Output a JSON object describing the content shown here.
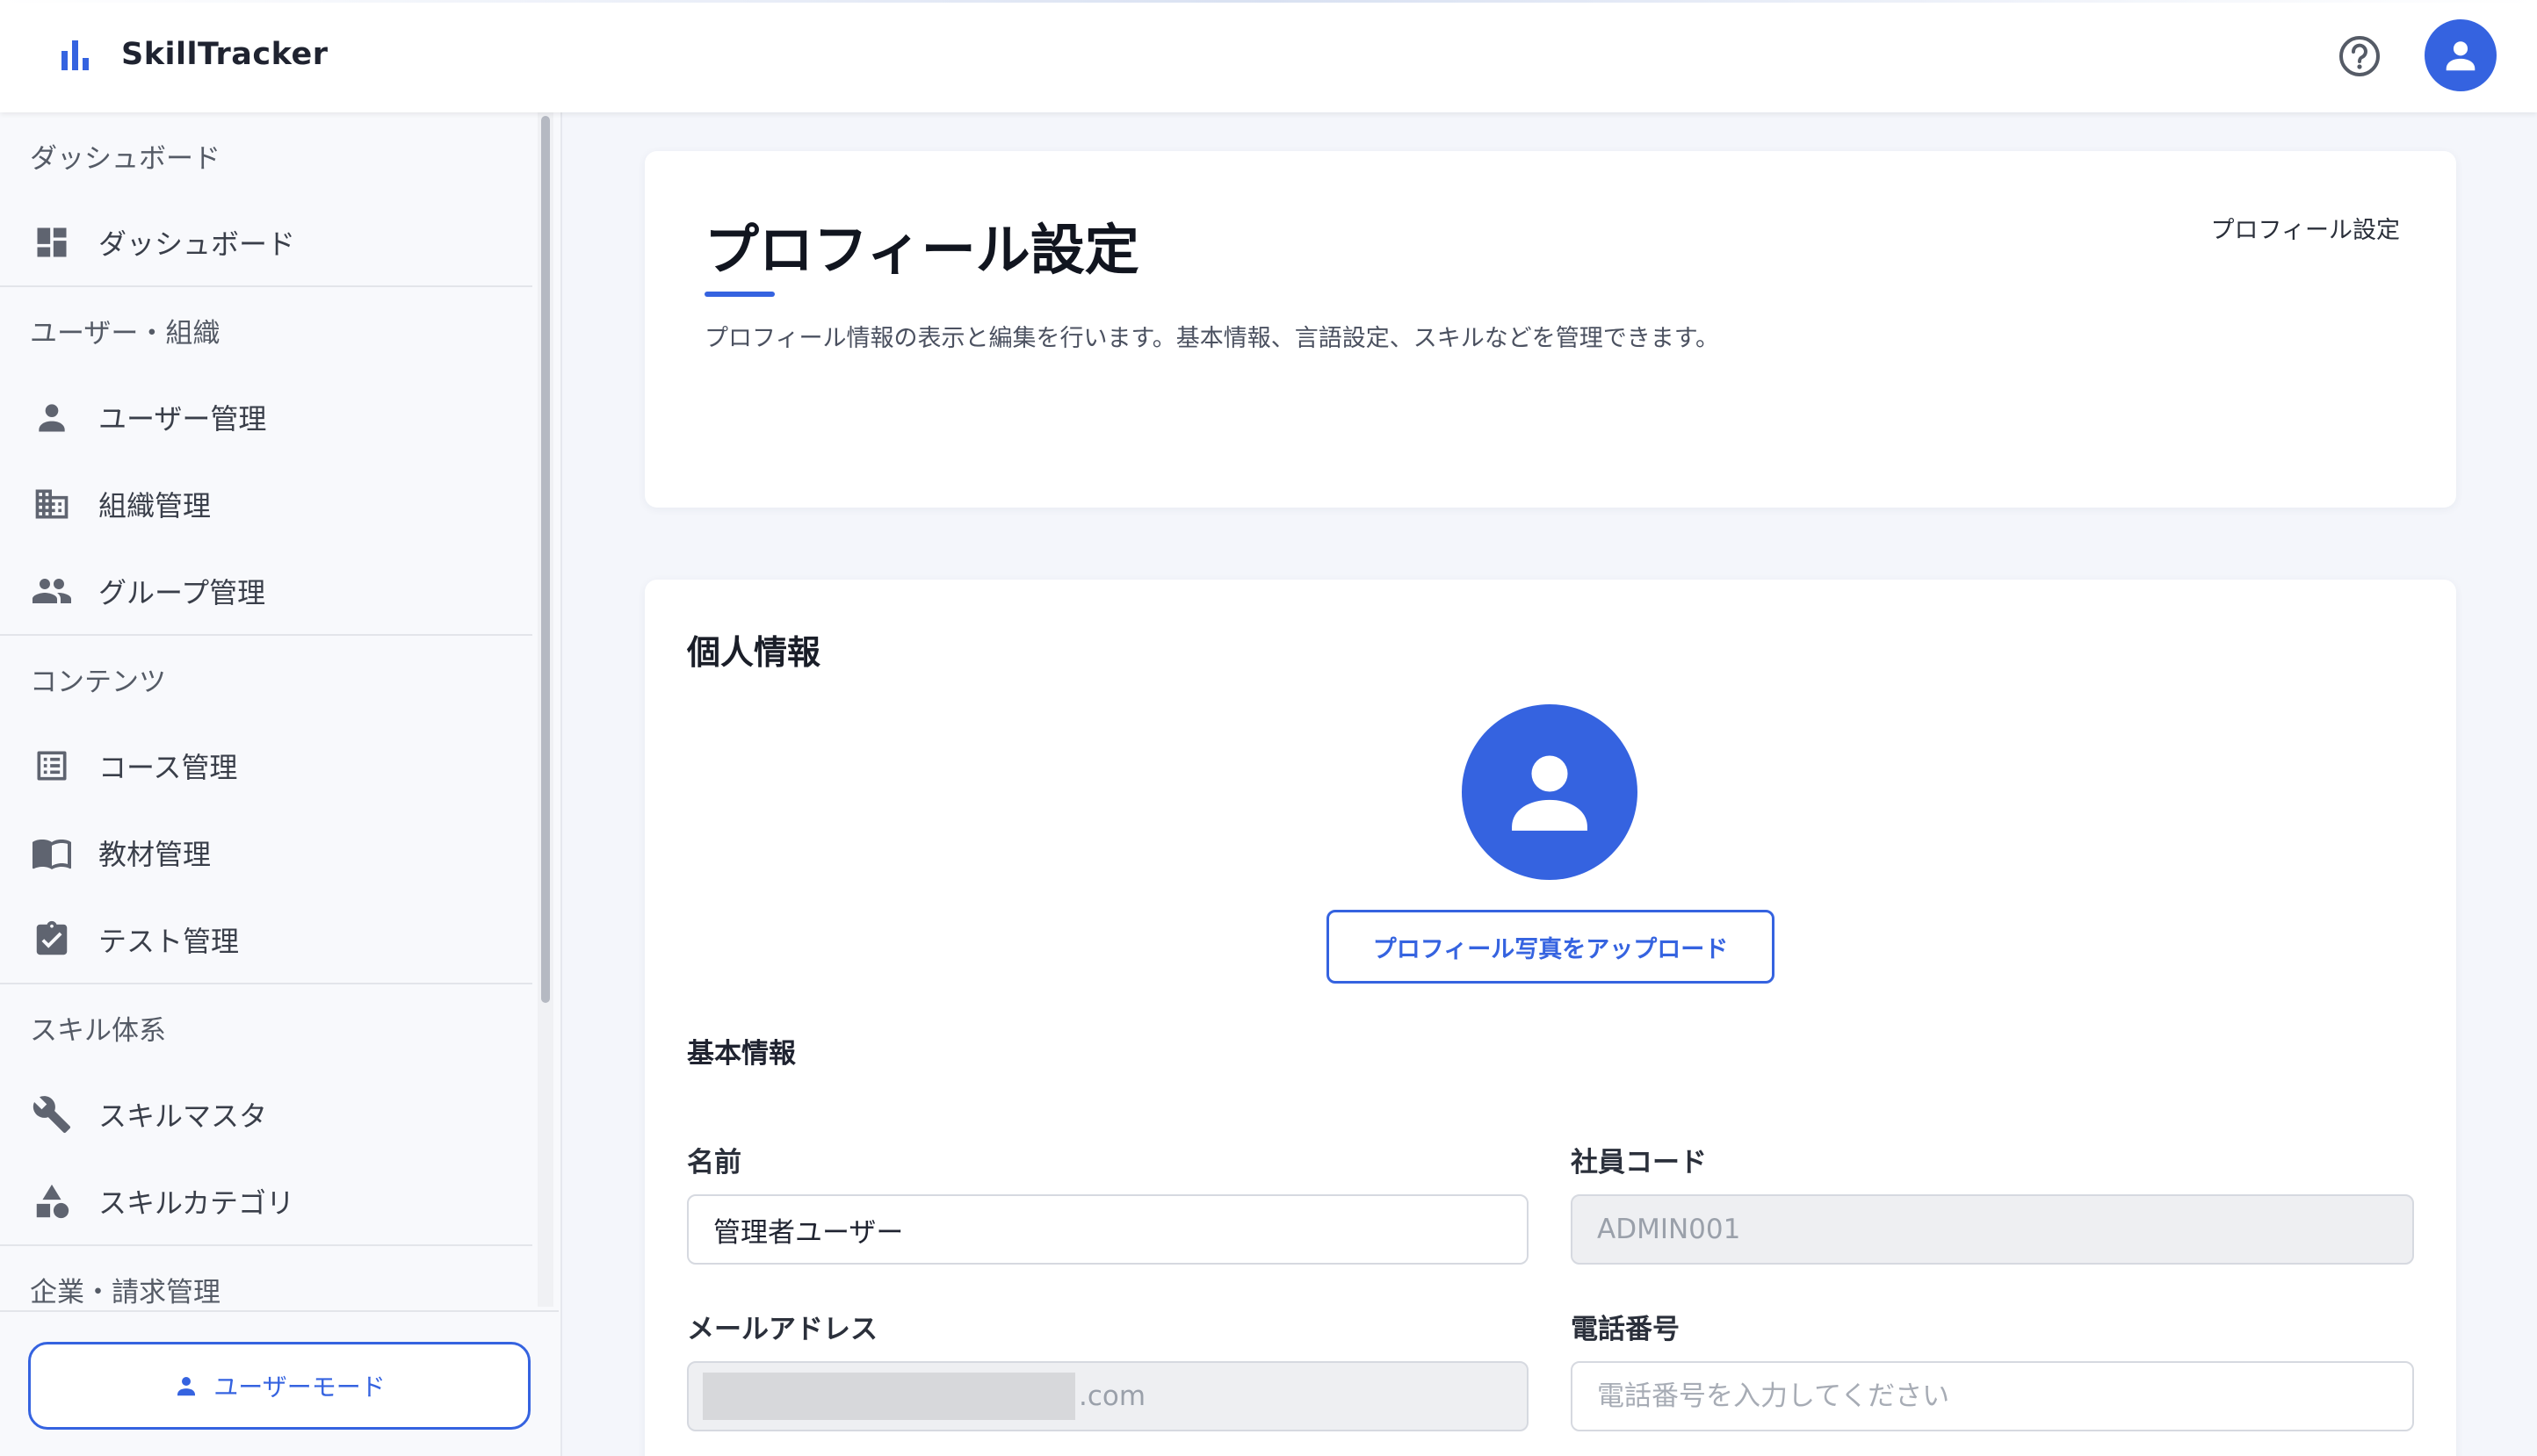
{
  "header": {
    "brand": "SkillTracker"
  },
  "sidebar": {
    "groups": [
      {
        "title": "ダッシュボード",
        "items": [
          {
            "label": "ダッシュボード",
            "icon": "dashboard-icon"
          }
        ]
      },
      {
        "title": "ユーザー・組織",
        "items": [
          {
            "label": "ユーザー管理",
            "icon": "person-icon"
          },
          {
            "label": "組織管理",
            "icon": "building-icon"
          },
          {
            "label": "グループ管理",
            "icon": "group-icon"
          }
        ]
      },
      {
        "title": "コンテンツ",
        "items": [
          {
            "label": "コース管理",
            "icon": "list-icon"
          },
          {
            "label": "教材管理",
            "icon": "book-icon"
          },
          {
            "label": "テスト管理",
            "icon": "clipboard-check-icon"
          }
        ]
      },
      {
        "title": "スキル体系",
        "items": [
          {
            "label": "スキルマスタ",
            "icon": "wrench-icon"
          },
          {
            "label": "スキルカテゴリ",
            "icon": "shapes-icon"
          }
        ]
      },
      {
        "title": "企業・請求管理",
        "items": []
      }
    ],
    "footer_button": "ユーザーモード"
  },
  "page": {
    "title": "プロフィール設定",
    "breadcrumb": "プロフィール設定",
    "description": "プロフィール情報の表示と編集を行います。基本情報、言語設定、スキルなどを管理できます。"
  },
  "personal": {
    "heading": "個人情報",
    "upload_label": "プロフィール写真をアップロード",
    "basic_heading": "基本情報",
    "name_label": "名前",
    "name_value": "管理者ユーザー",
    "code_label": "社員コード",
    "code_value": "ADMIN001",
    "email_label": "メールアドレス",
    "email_suffix": ".com",
    "phone_label": "電話番号",
    "phone_placeholder": "電話番号を入力してください"
  },
  "colors": {
    "accent": "#3563e0"
  }
}
